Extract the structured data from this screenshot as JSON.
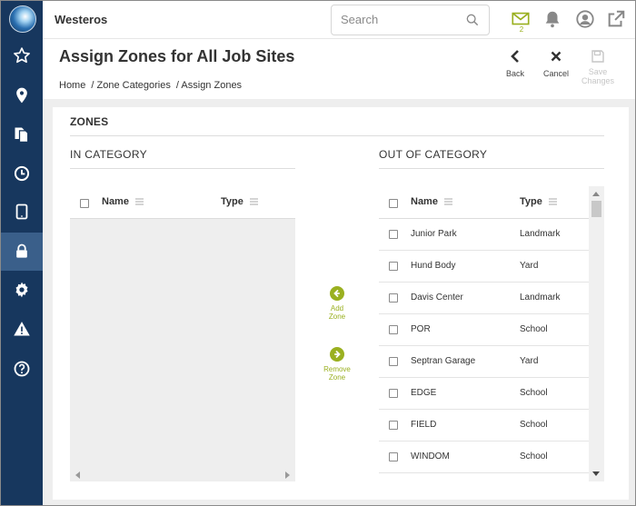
{
  "app": {
    "name": "Westeros"
  },
  "search": {
    "placeholder": "Search"
  },
  "header": {
    "mail_count": "2"
  },
  "page": {
    "title": "Assign Zones for All Job Sites",
    "breadcrumb": [
      "Home",
      "/ Zone Categories",
      "/ Assign Zones"
    ],
    "actions": {
      "back": "Back",
      "cancel": "Cancel",
      "save": "Save Changes"
    }
  },
  "sidebar": {
    "items": [
      {
        "icon": "star-icon"
      },
      {
        "icon": "map-pin-icon"
      },
      {
        "icon": "documents-icon"
      },
      {
        "icon": "clock-icon"
      },
      {
        "icon": "tablet-icon"
      },
      {
        "icon": "lock-icon",
        "active": true
      },
      {
        "icon": "gear-icon"
      },
      {
        "icon": "warning-icon"
      },
      {
        "icon": "help-icon"
      }
    ]
  },
  "zones": {
    "title": "ZONES",
    "in_category": {
      "title": "IN CATEGORY",
      "columns": [
        "Name",
        "Type"
      ],
      "rows": []
    },
    "out_of_category": {
      "title": "OUT OF CATEGORY",
      "columns": [
        "Name",
        "Type"
      ],
      "rows": [
        {
          "name": "Junior Park",
          "type": "Landmark"
        },
        {
          "name": "Hund Body",
          "type": "Yard"
        },
        {
          "name": "Davis Center",
          "type": "Landmark"
        },
        {
          "name": "POR",
          "type": "School"
        },
        {
          "name": "Septran Garage",
          "type": "Yard"
        },
        {
          "name": "EDGE",
          "type": "School"
        },
        {
          "name": "FIELD",
          "type": "School"
        },
        {
          "name": "WINDOM",
          "type": "School"
        }
      ]
    },
    "add_zone": {
      "line1": "Add",
      "line2": "Zone"
    },
    "remove_zone": {
      "line1": "Remove",
      "line2": "Zone"
    }
  },
  "colors": {
    "sidebar": "#17375e",
    "accent": "#9ab020",
    "sidebar_active": "#3a5f8a"
  }
}
